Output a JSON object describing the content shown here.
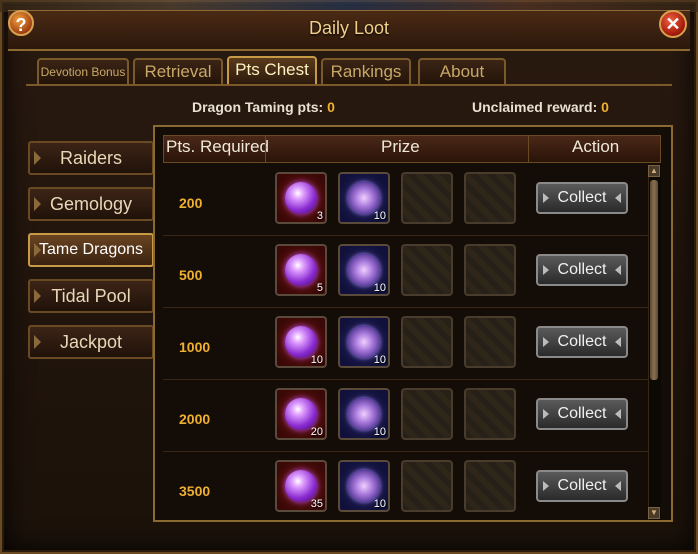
{
  "window": {
    "title": "Daily Loot"
  },
  "tabs": [
    {
      "label": "Devotion Bonus"
    },
    {
      "label": "Retrieval"
    },
    {
      "label": "Pts Chest"
    },
    {
      "label": "Rankings"
    },
    {
      "label": "About"
    }
  ],
  "info": {
    "taming_label": "Dragon Taming pts:",
    "taming_value": "0",
    "unclaimed_label": "Unclaimed reward:",
    "unclaimed_value": "0"
  },
  "sidebar": [
    {
      "label": "Raiders"
    },
    {
      "label": "Gemology"
    },
    {
      "label": "Tame Dragons"
    },
    {
      "label": "Tidal Pool"
    },
    {
      "label": "Jackpot"
    }
  ],
  "table": {
    "headers": [
      "Pts. Required",
      "Prize",
      "Action"
    ],
    "rows": [
      {
        "pts": "200",
        "orb_qty": "3",
        "gem_qty": "10",
        "action": "Collect"
      },
      {
        "pts": "500",
        "orb_qty": "5",
        "gem_qty": "10",
        "action": "Collect"
      },
      {
        "pts": "1000",
        "orb_qty": "10",
        "gem_qty": "10",
        "action": "Collect"
      },
      {
        "pts": "2000",
        "orb_qty": "20",
        "gem_qty": "10",
        "action": "Collect"
      },
      {
        "pts": "3500",
        "orb_qty": "35",
        "gem_qty": "10",
        "action": "Collect"
      }
    ]
  },
  "icons": {
    "help": "?",
    "close": "✕",
    "scroll_up": "▲",
    "scroll_down": "▼"
  },
  "colors": {
    "accent": "#f0b030",
    "title": "#f0d08a"
  }
}
